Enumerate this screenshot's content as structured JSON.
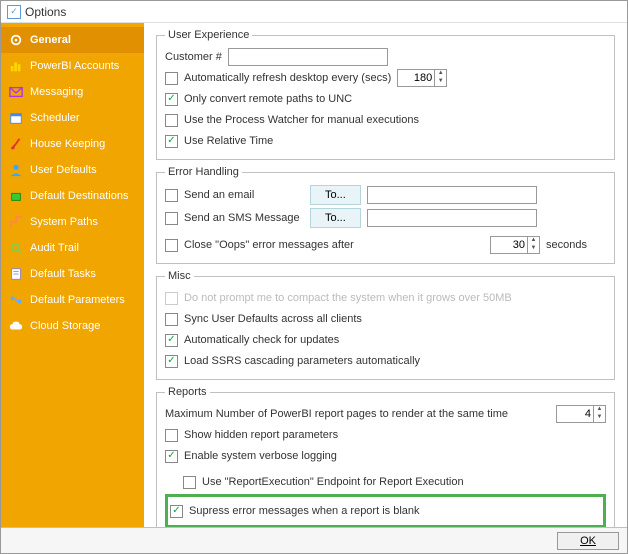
{
  "window": {
    "title": "Options"
  },
  "sidebar": {
    "items": [
      {
        "label": "General",
        "icon": "gear"
      },
      {
        "label": "PowerBI Accounts",
        "icon": "bar"
      },
      {
        "label": "Messaging",
        "icon": "msg"
      },
      {
        "label": "Scheduler",
        "icon": "cal"
      },
      {
        "label": "House Keeping",
        "icon": "broom"
      },
      {
        "label": "User Defaults",
        "icon": "user"
      },
      {
        "label": "Default Destinations",
        "icon": "dest"
      },
      {
        "label": "System Paths",
        "icon": "path"
      },
      {
        "label": "Audit Trail",
        "icon": "audit"
      },
      {
        "label": "Default Tasks",
        "icon": "task"
      },
      {
        "label": "Default Parameters",
        "icon": "param"
      },
      {
        "label": "Cloud Storage",
        "icon": "cloud"
      }
    ]
  },
  "ux": {
    "legend": "User Experience",
    "customer_label": "Customer #",
    "customer_value": "",
    "auto_refresh": "Automatically refresh desktop every (secs)",
    "auto_refresh_value": "180",
    "only_convert": "Only convert remote paths to UNC",
    "use_process_watcher": "Use the Process Watcher for manual executions",
    "use_relative_time": "Use Relative Time"
  },
  "err": {
    "legend": "Error Handling",
    "send_email": "Send an email",
    "send_sms": "Send an SMS Message",
    "to": "To...",
    "close_oops": "Close \"Oops\" error messages after",
    "close_oops_value": "30",
    "seconds": "seconds"
  },
  "misc": {
    "legend": "Misc",
    "no_prompt": "Do not prompt me to compact the system when it grows over 50MB",
    "sync_user": "Sync User Defaults across all clients",
    "auto_check": "Automatically check for updates",
    "load_ssrs": "Load SSRS cascading parameters automatically"
  },
  "reports": {
    "legend": "Reports",
    "max_pages": "Maximum Number of PowerBI report pages to render at the same time",
    "max_pages_value": "4",
    "show_hidden": "Show hidden report parameters",
    "verbose": "Enable system verbose logging",
    "report_exec": "Use \"ReportExecution\" Endpoint for Report Execution",
    "suppress": "Supress error messages when a report is blank"
  },
  "footer": {
    "ok": "OK"
  }
}
